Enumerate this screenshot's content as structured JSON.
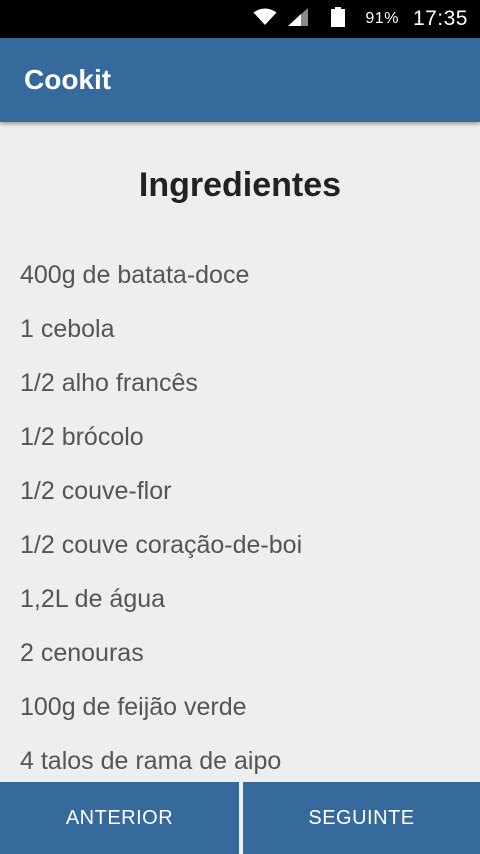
{
  "status_bar": {
    "battery": "91%",
    "time": "17:35",
    "icons": [
      "wifi-icon",
      "signal-icon",
      "battery-icon"
    ]
  },
  "app_bar": {
    "title": "Cookit",
    "color": "#376a9c"
  },
  "main": {
    "section_title": "Ingredientes",
    "ingredients": [
      "400g de batata-doce",
      "1 cebola",
      "1/2 alho francês",
      "1/2 brócolo",
      "1/2 couve-flor",
      "1/2 couve coração-de-boi",
      "1,2L de água",
      "2 cenouras",
      "100g de feijão verde",
      "4 talos de rama de aipo"
    ]
  },
  "bottom_nav": {
    "prev_label": "ANTERIOR",
    "next_label": "SEGUINTE"
  }
}
